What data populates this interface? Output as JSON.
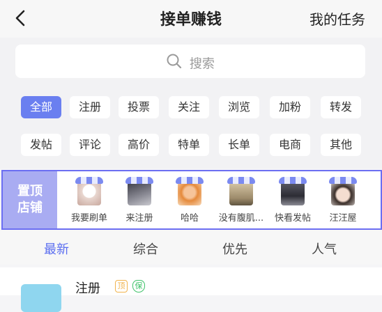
{
  "header": {
    "title": "接单赚钱",
    "right_label": "我的任务"
  },
  "search": {
    "placeholder": "搜索"
  },
  "categories": [
    {
      "label": "全部",
      "active": true
    },
    {
      "label": "注册"
    },
    {
      "label": "投票"
    },
    {
      "label": "关注"
    },
    {
      "label": "浏览"
    },
    {
      "label": "加粉"
    },
    {
      "label": "转发"
    },
    {
      "label": "发帖"
    },
    {
      "label": "评论"
    },
    {
      "label": "高价"
    },
    {
      "label": "特单"
    },
    {
      "label": "长单"
    },
    {
      "label": "电商"
    },
    {
      "label": "其他"
    }
  ],
  "featured": {
    "label_line1": "置顶",
    "label_line2": "店铺",
    "shops": [
      {
        "name": "我要刷单"
      },
      {
        "name": "来注册"
      },
      {
        "name": "哈哈"
      },
      {
        "name": "没有腹肌..."
      },
      {
        "name": "快看发帖"
      },
      {
        "name": "汪汪屋"
      }
    ]
  },
  "sort_tabs": [
    {
      "label": "最新",
      "active": true
    },
    {
      "label": "综合"
    },
    {
      "label": "优先"
    },
    {
      "label": "人气"
    }
  ],
  "task": {
    "title": "注册",
    "badge_top": "顶",
    "badge_guarantee": "保"
  },
  "colors": {
    "accent": "#6a7ff0",
    "featured_border": "#6b6ef2",
    "featured_label_bg": "#a9acf2"
  }
}
